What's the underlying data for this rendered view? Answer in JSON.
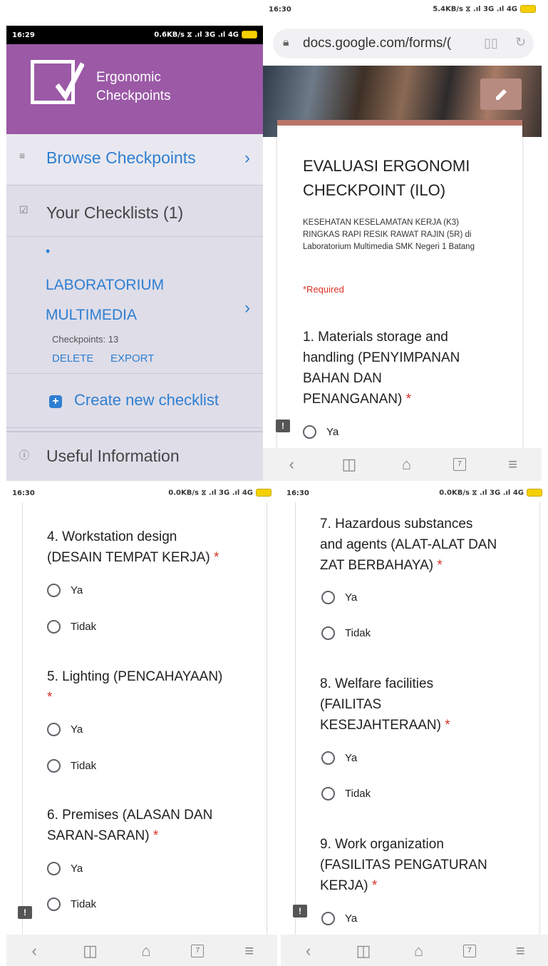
{
  "screen1": {
    "status": {
      "time": "16:29",
      "indicators": "0.6KB/s ⧖ .ıl 3G .ıl 4G"
    },
    "app_title_line1": "Ergonomic",
    "app_title_line2": "Checkpoints",
    "browse_label": "Browse Checkpoints",
    "checklists_label": "Your Checklists (1)",
    "checklist_name_line1": "LABORATORIUM",
    "checklist_name_line2": "MULTIMEDIA",
    "checkpoints_count": "Checkpoints: 13",
    "delete_label": "DELETE",
    "export_label": "EXPORT",
    "create_label": "Create new checklist",
    "useful_label": "Useful Information"
  },
  "screen2": {
    "status": {
      "time": "16:30",
      "indicators": "5.4KB/s ⧖ .ıl 3G .ıl 4G"
    },
    "url": "docs.google.com/forms/(",
    "form_title_line1": "EVALUASI ERGONOMI",
    "form_title_line2": "CHECKPOINT (ILO)",
    "description": "KESEHATAN KESELAMATAN KERJA (K3) RINGKAS RAPI RESIK RAWAT RAJIN (5R) di Laboratorium Multimedia SMK Negeri 1 Batang",
    "required_note": "*Required",
    "q1_lines": [
      "1. Materials storage and",
      "handling (PENYIMPANAN",
      "BAHAN DAN",
      "PENANGANAN)"
    ],
    "opt_ya": "Ya"
  },
  "screen3": {
    "status": {
      "time": "16:30",
      "indicators": "0.0KB/s ⧖ .ıl 3G .ıl 4G"
    },
    "q4_lines": [
      "4. Workstation design",
      "(DESAIN TEMPAT KERJA)"
    ],
    "q5_lines": [
      "5. Lighting (PENCAHAYAAN)"
    ],
    "q6_lines": [
      "6. Premises (ALASAN DAN",
      "SARAN-SARAN)"
    ],
    "opt_ya": "Ya",
    "opt_tidak": "Tidak"
  },
  "screen4": {
    "status": {
      "time": "16:30",
      "indicators": "0.0KB/s ⧖ .ıl 3G .ıl 4G"
    },
    "q7_lines": [
      "7. Hazardous substances",
      "and agents (ALAT-ALAT DAN",
      "ZAT BERBAHAYA)"
    ],
    "q8_lines": [
      "8. Welfare facilities",
      "(FAILITAS",
      "KESEJAHTERAAN)"
    ],
    "q9_lines": [
      "9. Work organization",
      "(FASILITAS PENGATURAN",
      "KERJA)"
    ],
    "opt_ya": "Ya",
    "opt_tidak": "Tidak"
  },
  "common": {
    "required_star": "*",
    "feedback_glyph": "!",
    "tabs_count": "7",
    "accent_purple": "#9b59a6",
    "link_blue": "#2e7fd1",
    "required_red": "#d93025"
  }
}
